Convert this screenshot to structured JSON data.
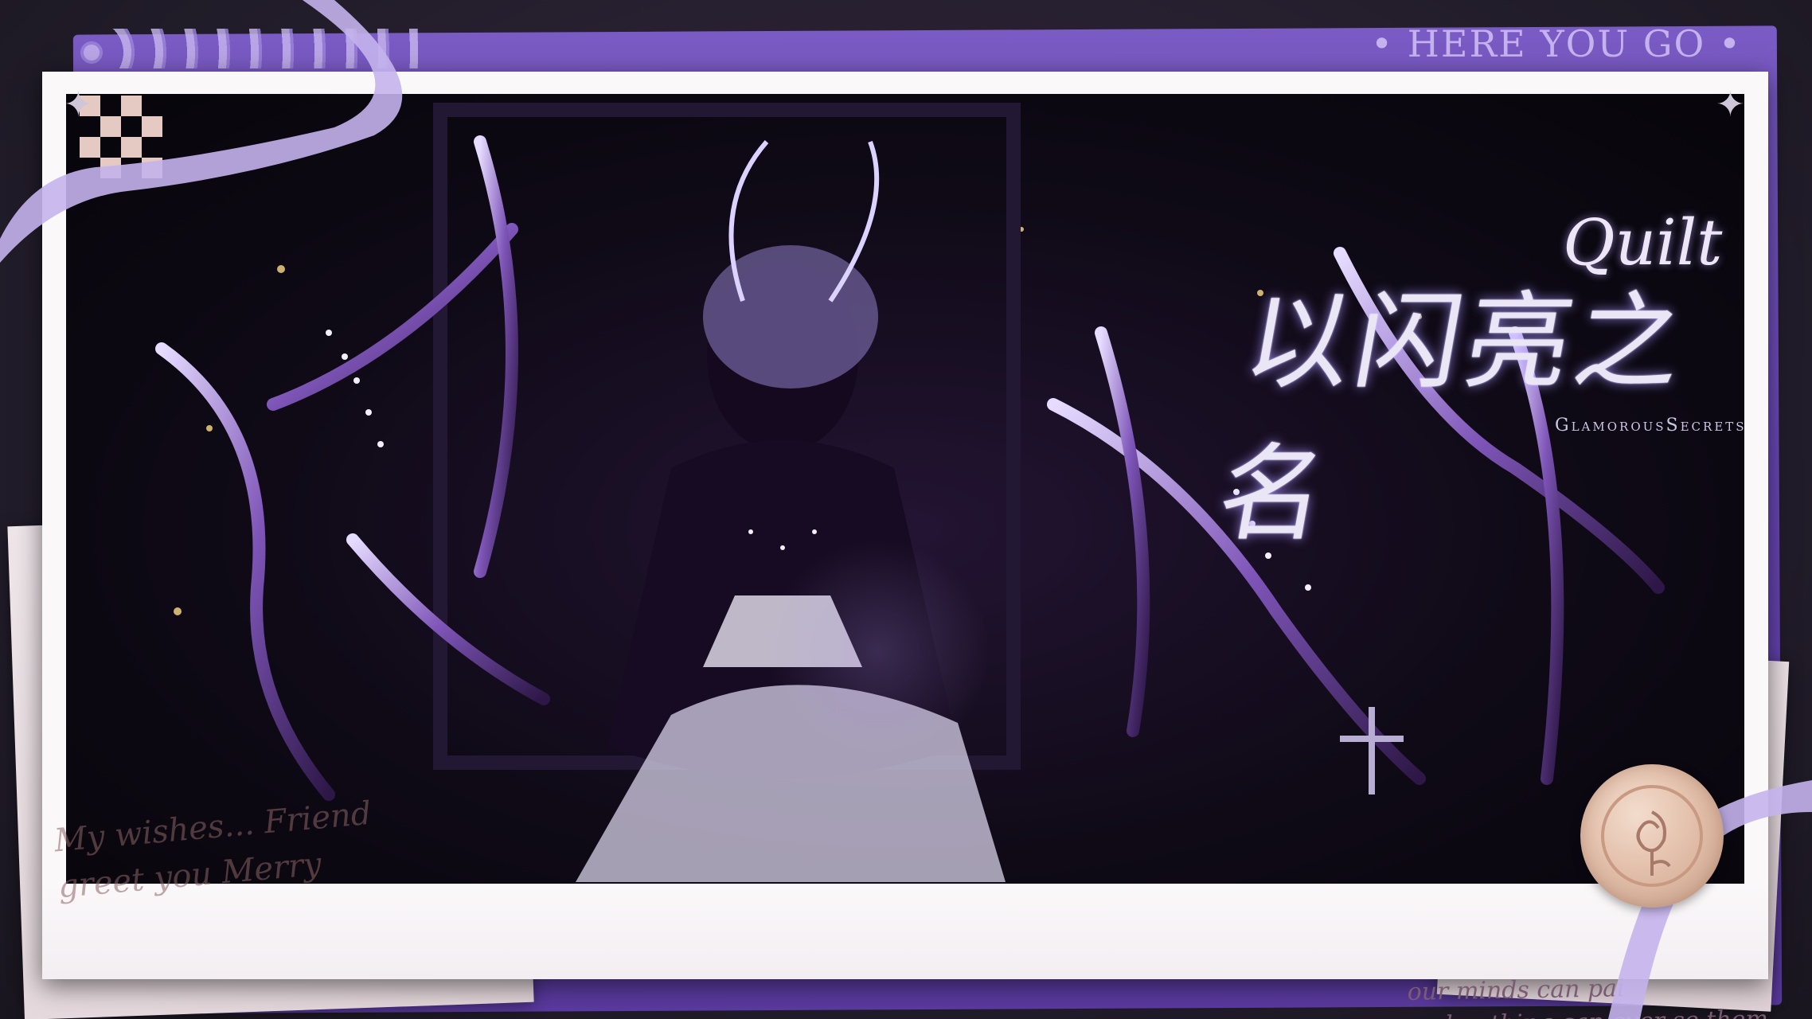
{
  "header": {
    "tagline": "• HERE YOU GO •"
  },
  "title": {
    "latin": "Quilt",
    "chinese": "以闪亮之名",
    "subtitle": "GlamorousSecrets"
  },
  "footer": {
    "script_right_line1": "our minds can pai",
    "script_right_line2": "and nothing can ever se them",
    "script_left_line1": "My wishes... Friend",
    "script_left_line2": "greet you  Merry"
  },
  "icons": [
    "wax-seal-rose-icon",
    "sparkle-star-icon",
    "ribbon-decoration"
  ],
  "colors": {
    "accent": "#7a5bc4",
    "frame": "#fbf8fa",
    "photo_bg": "#0f0a16",
    "title": "#eae6f6"
  }
}
